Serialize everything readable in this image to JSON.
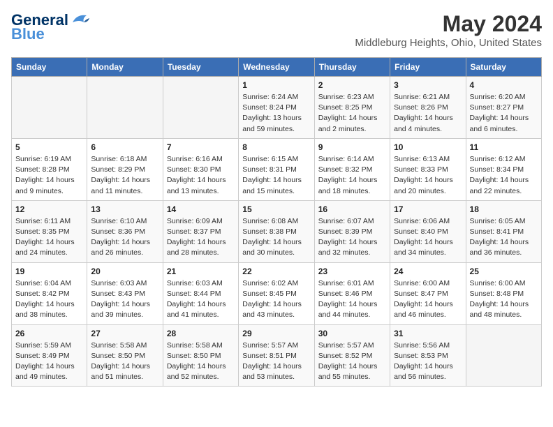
{
  "header": {
    "logo_line1": "General",
    "logo_line2": "Blue",
    "title": "May 2024",
    "subtitle": "Middleburg Heights, Ohio, United States"
  },
  "weekdays": [
    "Sunday",
    "Monday",
    "Tuesday",
    "Wednesday",
    "Thursday",
    "Friday",
    "Saturday"
  ],
  "weeks": [
    [
      {
        "day": "",
        "info": ""
      },
      {
        "day": "",
        "info": ""
      },
      {
        "day": "",
        "info": ""
      },
      {
        "day": "1",
        "info": "Sunrise: 6:24 AM\nSunset: 8:24 PM\nDaylight: 13 hours\nand 59 minutes."
      },
      {
        "day": "2",
        "info": "Sunrise: 6:23 AM\nSunset: 8:25 PM\nDaylight: 14 hours\nand 2 minutes."
      },
      {
        "day": "3",
        "info": "Sunrise: 6:21 AM\nSunset: 8:26 PM\nDaylight: 14 hours\nand 4 minutes."
      },
      {
        "day": "4",
        "info": "Sunrise: 6:20 AM\nSunset: 8:27 PM\nDaylight: 14 hours\nand 6 minutes."
      }
    ],
    [
      {
        "day": "5",
        "info": "Sunrise: 6:19 AM\nSunset: 8:28 PM\nDaylight: 14 hours\nand 9 minutes."
      },
      {
        "day": "6",
        "info": "Sunrise: 6:18 AM\nSunset: 8:29 PM\nDaylight: 14 hours\nand 11 minutes."
      },
      {
        "day": "7",
        "info": "Sunrise: 6:16 AM\nSunset: 8:30 PM\nDaylight: 14 hours\nand 13 minutes."
      },
      {
        "day": "8",
        "info": "Sunrise: 6:15 AM\nSunset: 8:31 PM\nDaylight: 14 hours\nand 15 minutes."
      },
      {
        "day": "9",
        "info": "Sunrise: 6:14 AM\nSunset: 8:32 PM\nDaylight: 14 hours\nand 18 minutes."
      },
      {
        "day": "10",
        "info": "Sunrise: 6:13 AM\nSunset: 8:33 PM\nDaylight: 14 hours\nand 20 minutes."
      },
      {
        "day": "11",
        "info": "Sunrise: 6:12 AM\nSunset: 8:34 PM\nDaylight: 14 hours\nand 22 minutes."
      }
    ],
    [
      {
        "day": "12",
        "info": "Sunrise: 6:11 AM\nSunset: 8:35 PM\nDaylight: 14 hours\nand 24 minutes."
      },
      {
        "day": "13",
        "info": "Sunrise: 6:10 AM\nSunset: 8:36 PM\nDaylight: 14 hours\nand 26 minutes."
      },
      {
        "day": "14",
        "info": "Sunrise: 6:09 AM\nSunset: 8:37 PM\nDaylight: 14 hours\nand 28 minutes."
      },
      {
        "day": "15",
        "info": "Sunrise: 6:08 AM\nSunset: 8:38 PM\nDaylight: 14 hours\nand 30 minutes."
      },
      {
        "day": "16",
        "info": "Sunrise: 6:07 AM\nSunset: 8:39 PM\nDaylight: 14 hours\nand 32 minutes."
      },
      {
        "day": "17",
        "info": "Sunrise: 6:06 AM\nSunset: 8:40 PM\nDaylight: 14 hours\nand 34 minutes."
      },
      {
        "day": "18",
        "info": "Sunrise: 6:05 AM\nSunset: 8:41 PM\nDaylight: 14 hours\nand 36 minutes."
      }
    ],
    [
      {
        "day": "19",
        "info": "Sunrise: 6:04 AM\nSunset: 8:42 PM\nDaylight: 14 hours\nand 38 minutes."
      },
      {
        "day": "20",
        "info": "Sunrise: 6:03 AM\nSunset: 8:43 PM\nDaylight: 14 hours\nand 39 minutes."
      },
      {
        "day": "21",
        "info": "Sunrise: 6:03 AM\nSunset: 8:44 PM\nDaylight: 14 hours\nand 41 minutes."
      },
      {
        "day": "22",
        "info": "Sunrise: 6:02 AM\nSunset: 8:45 PM\nDaylight: 14 hours\nand 43 minutes."
      },
      {
        "day": "23",
        "info": "Sunrise: 6:01 AM\nSunset: 8:46 PM\nDaylight: 14 hours\nand 44 minutes."
      },
      {
        "day": "24",
        "info": "Sunrise: 6:00 AM\nSunset: 8:47 PM\nDaylight: 14 hours\nand 46 minutes."
      },
      {
        "day": "25",
        "info": "Sunrise: 6:00 AM\nSunset: 8:48 PM\nDaylight: 14 hours\nand 48 minutes."
      }
    ],
    [
      {
        "day": "26",
        "info": "Sunrise: 5:59 AM\nSunset: 8:49 PM\nDaylight: 14 hours\nand 49 minutes."
      },
      {
        "day": "27",
        "info": "Sunrise: 5:58 AM\nSunset: 8:50 PM\nDaylight: 14 hours\nand 51 minutes."
      },
      {
        "day": "28",
        "info": "Sunrise: 5:58 AM\nSunset: 8:50 PM\nDaylight: 14 hours\nand 52 minutes."
      },
      {
        "day": "29",
        "info": "Sunrise: 5:57 AM\nSunset: 8:51 PM\nDaylight: 14 hours\nand 53 minutes."
      },
      {
        "day": "30",
        "info": "Sunrise: 5:57 AM\nSunset: 8:52 PM\nDaylight: 14 hours\nand 55 minutes."
      },
      {
        "day": "31",
        "info": "Sunrise: 5:56 AM\nSunset: 8:53 PM\nDaylight: 14 hours\nand 56 minutes."
      },
      {
        "day": "",
        "info": ""
      }
    ]
  ]
}
